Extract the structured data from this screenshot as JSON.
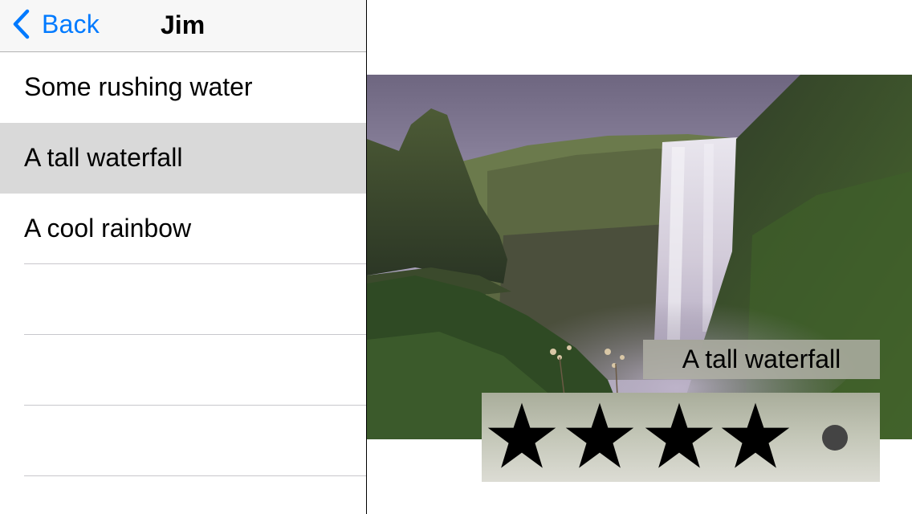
{
  "navbar": {
    "back_label": "Back",
    "title": "Jim"
  },
  "list": {
    "items": [
      {
        "label": "Some rushing water",
        "selected": false
      },
      {
        "label": "A tall waterfall",
        "selected": true
      },
      {
        "label": "A cool rainbow",
        "selected": false
      }
    ]
  },
  "detail": {
    "caption": "A tall waterfall",
    "rating": 4,
    "rating_max": 5
  },
  "colors": {
    "accent": "#007aff",
    "selected_row": "#d9d9d9",
    "star": "#000000"
  },
  "icons": {
    "back": "chevron-left-icon",
    "rating": "star-icon"
  }
}
